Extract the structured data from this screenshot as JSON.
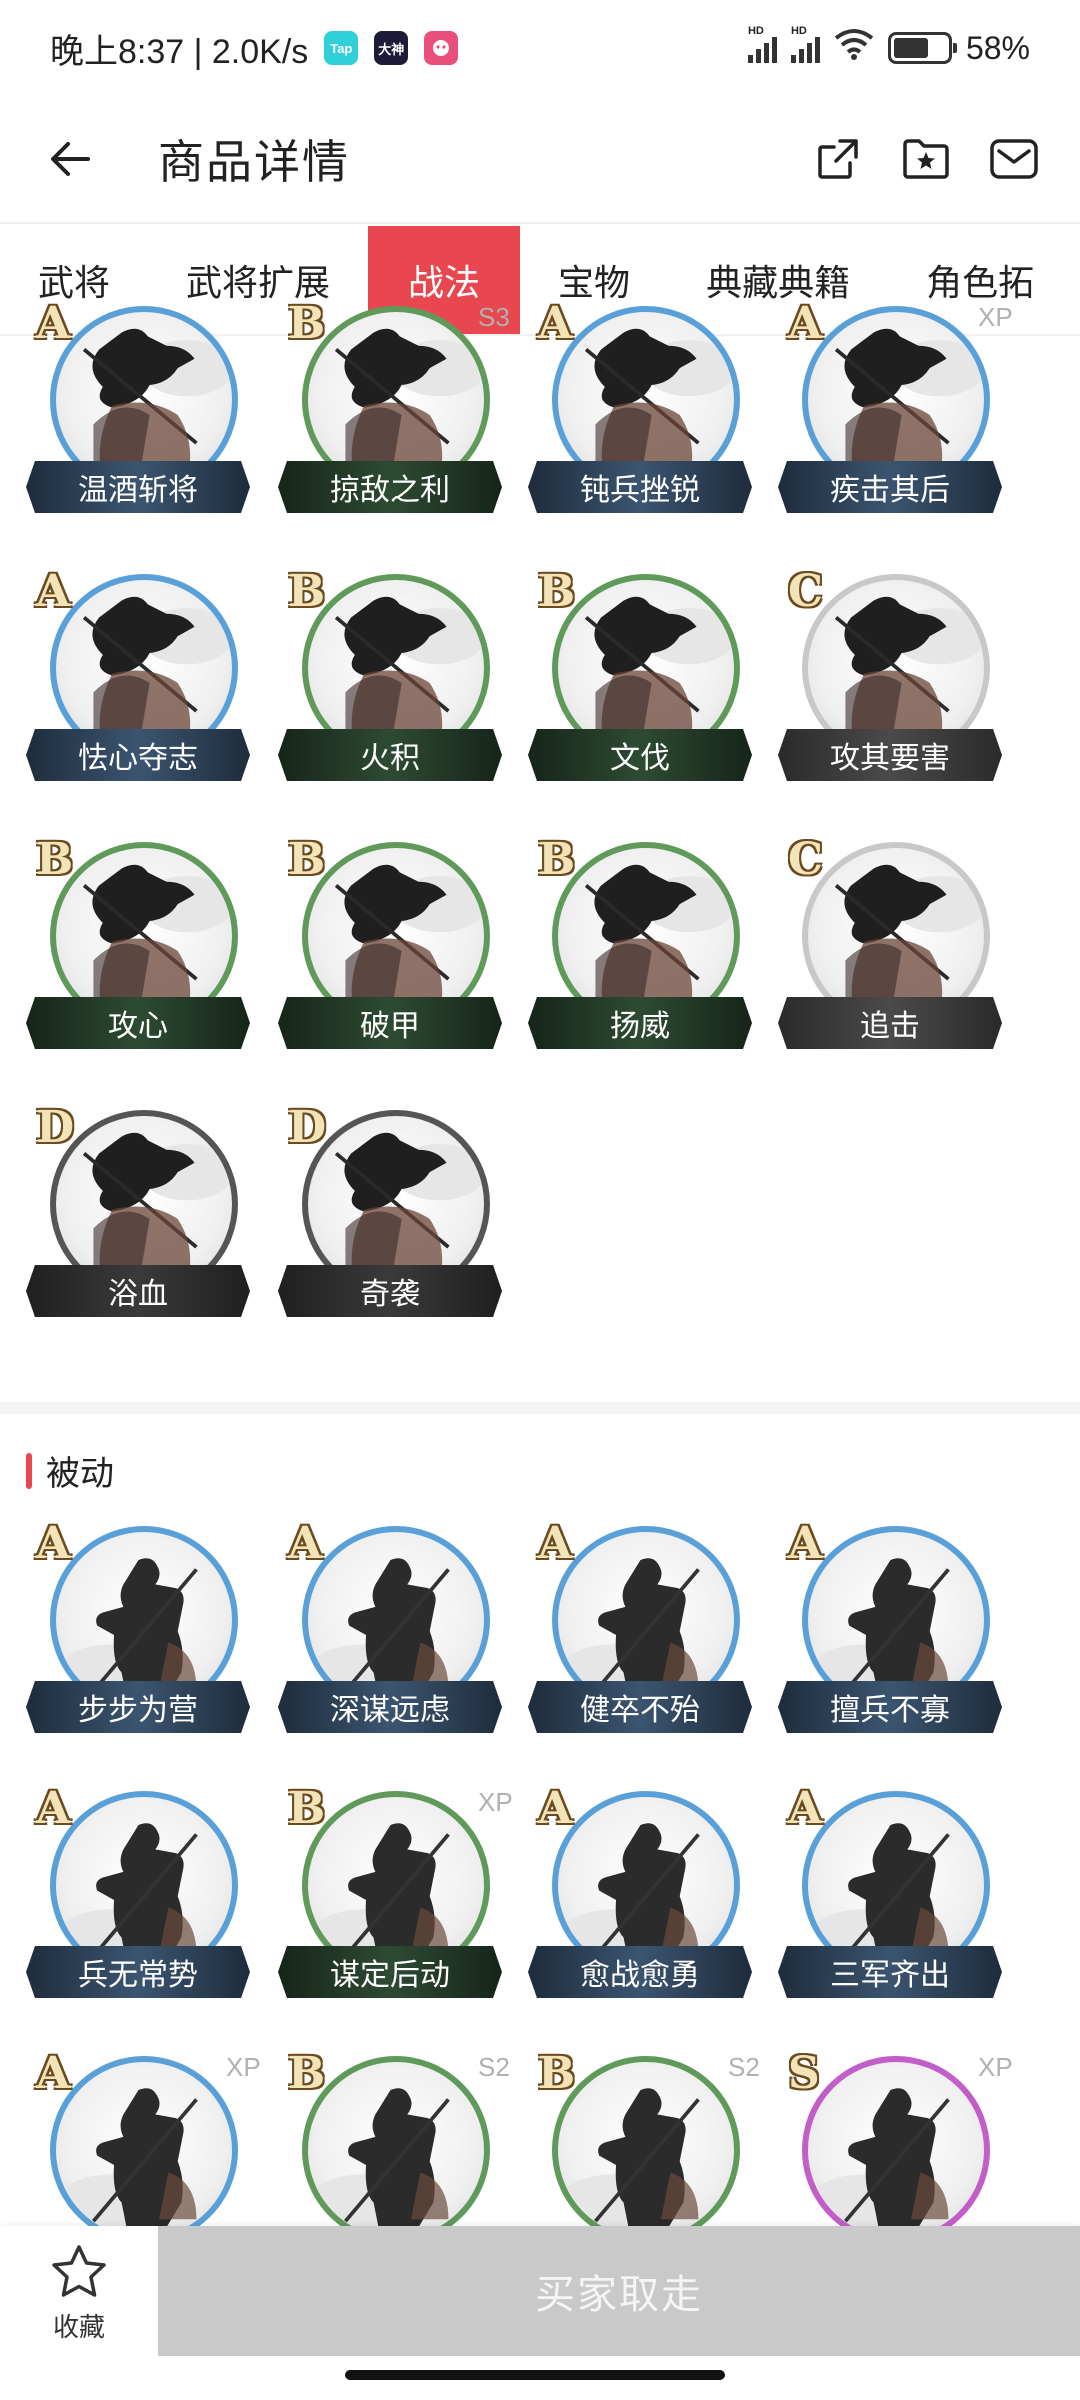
{
  "status_bar": {
    "time_text": "晚上8:37 | 2.0K/s",
    "apps": [
      {
        "label": "Tap",
        "color": "#2fd0d8"
      },
      {
        "label": "大神",
        "color": "#1c1c3a"
      },
      {
        "label": "",
        "color": "#e94f7a"
      }
    ],
    "battery_percent": "58%",
    "battery_level": 0.58
  },
  "header": {
    "title": "商品详情"
  },
  "tabs": [
    {
      "label": "武将",
      "active": false
    },
    {
      "label": "武将扩展",
      "active": false
    },
    {
      "label": "战法",
      "active": true
    },
    {
      "label": "宝物",
      "active": false
    },
    {
      "label": "典藏典籍",
      "active": false
    },
    {
      "label": "角色拓",
      "active": false
    }
  ],
  "active_section": {
    "rows": [
      [
        {
          "grade": "A",
          "name": "温酒斩将",
          "tag": "",
          "color": "blue"
        },
        {
          "grade": "B",
          "name": "掠敌之利",
          "tag": "S3",
          "color": "green"
        },
        {
          "grade": "A",
          "name": "钝兵挫锐",
          "tag": "",
          "color": "blue"
        },
        {
          "grade": "A",
          "name": "疾击其后",
          "tag": "XP",
          "color": "blue"
        }
      ],
      [
        {
          "grade": "A",
          "name": "怯心夺志",
          "tag": "",
          "color": "blue"
        },
        {
          "grade": "B",
          "name": "火积",
          "tag": "",
          "color": "green"
        },
        {
          "grade": "B",
          "name": "文伐",
          "tag": "",
          "color": "green"
        },
        {
          "grade": "C",
          "name": "攻其要害",
          "tag": "",
          "color": "gray"
        }
      ],
      [
        {
          "grade": "B",
          "name": "攻心",
          "tag": "",
          "color": "green"
        },
        {
          "grade": "B",
          "name": "破甲",
          "tag": "",
          "color": "green"
        },
        {
          "grade": "B",
          "name": "扬威",
          "tag": "",
          "color": "green"
        },
        {
          "grade": "C",
          "name": "追击",
          "tag": "",
          "color": "gray"
        }
      ],
      [
        {
          "grade": "D",
          "name": "浴血",
          "tag": "",
          "color": "dark"
        },
        {
          "grade": "D",
          "name": "奇袭",
          "tag": "",
          "color": "dark"
        }
      ]
    ]
  },
  "passive_section": {
    "title": "被动",
    "rows": [
      [
        {
          "grade": "A",
          "name": "步步为营",
          "tag": "",
          "color": "blue"
        },
        {
          "grade": "A",
          "name": "深谋远虑",
          "tag": "",
          "color": "blue"
        },
        {
          "grade": "A",
          "name": "健卒不殆",
          "tag": "",
          "color": "blue"
        },
        {
          "grade": "A",
          "name": "擅兵不寡",
          "tag": "",
          "color": "blue"
        }
      ],
      [
        {
          "grade": "A",
          "name": "兵无常势",
          "tag": "",
          "color": "blue"
        },
        {
          "grade": "B",
          "name": "谋定后动",
          "tag": "XP",
          "color": "green"
        },
        {
          "grade": "A",
          "name": "愈战愈勇",
          "tag": "",
          "color": "blue"
        },
        {
          "grade": "A",
          "name": "三军齐出",
          "tag": "",
          "color": "blue"
        }
      ],
      [
        {
          "grade": "A",
          "name": "",
          "tag": "XP",
          "color": "blue"
        },
        {
          "grade": "B",
          "name": "",
          "tag": "S2",
          "color": "green"
        },
        {
          "grade": "B",
          "name": "",
          "tag": "S2",
          "color": "green"
        },
        {
          "grade": "S",
          "name": "",
          "tag": "XP",
          "color": "purple"
        }
      ]
    ]
  },
  "bottom_bar": {
    "favorite_label": "收藏",
    "buy_label": "买家取走"
  }
}
